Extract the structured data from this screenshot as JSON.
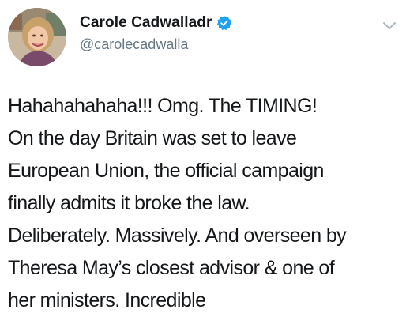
{
  "author": {
    "display_name": "Carole Cadwalladr",
    "handle": "@carolecadwalla",
    "verified": true,
    "avatar_icon": "profile-photo",
    "verified_icon": "verified-badge-icon",
    "menu_icon": "chevron-down-icon"
  },
  "tweet": {
    "lines": [
      "Hahahahahaha!!! Omg. The TIMING!",
      "On the day Britain was set to leave",
      "European Union, the official campaign",
      "finally admits it broke the law.",
      "Deliberately. Massively. And overseen by",
      "Theresa May’s closest advisor & one of",
      "her ministers. Incredible"
    ]
  },
  "colors": {
    "text": "#14171a",
    "secondary": "#657786",
    "verified_blue": "#1da1f2",
    "chevron": "#aab8c2"
  }
}
